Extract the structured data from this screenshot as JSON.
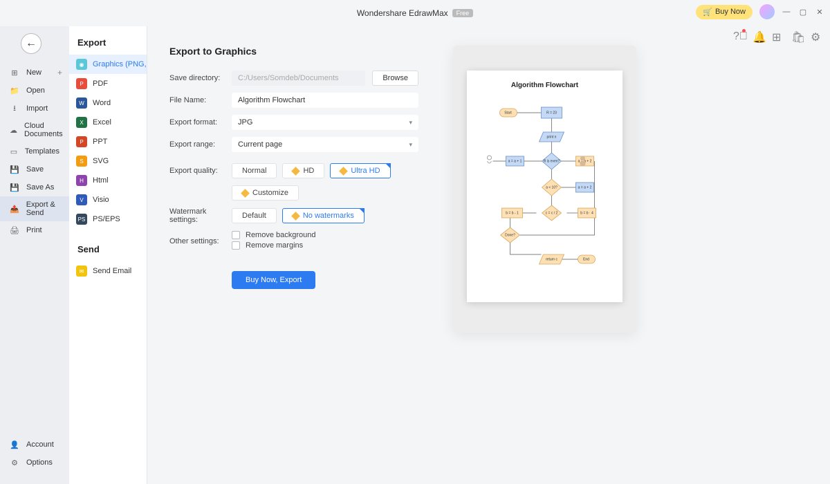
{
  "app": {
    "title": "Wondershare EdrawMax",
    "badge": "Free",
    "buy_now": "Buy Now"
  },
  "sidebar_a": {
    "items": [
      {
        "icon": "plus-box",
        "label": "New",
        "has_plus": true
      },
      {
        "icon": "folder",
        "label": "Open"
      },
      {
        "icon": "download",
        "label": "Import"
      },
      {
        "icon": "cloud",
        "label": "Cloud Documents"
      },
      {
        "icon": "template",
        "label": "Templates"
      },
      {
        "icon": "save",
        "label": "Save"
      },
      {
        "icon": "saveas",
        "label": "Save As"
      },
      {
        "icon": "export",
        "label": "Export & Send",
        "active": true
      },
      {
        "icon": "print",
        "label": "Print"
      }
    ],
    "bottom": [
      {
        "icon": "account",
        "label": "Account"
      },
      {
        "icon": "gear",
        "label": "Options"
      }
    ]
  },
  "sidebar_b": {
    "heading_export": "Export",
    "heading_send": "Send",
    "export_items": [
      {
        "cls": "fi-img",
        "label": "Graphics (PNG, JPG e...",
        "active": true
      },
      {
        "cls": "fi-pdf",
        "label": "PDF"
      },
      {
        "cls": "fi-word",
        "label": "Word"
      },
      {
        "cls": "fi-xls",
        "label": "Excel"
      },
      {
        "cls": "fi-ppt",
        "label": "PPT"
      },
      {
        "cls": "fi-svg",
        "label": "SVG"
      },
      {
        "cls": "fi-html",
        "label": "Html"
      },
      {
        "cls": "fi-visio",
        "label": "Visio"
      },
      {
        "cls": "fi-ps",
        "label": "PS/EPS"
      }
    ],
    "send_items": [
      {
        "cls": "fi-mail",
        "label": "Send Email"
      }
    ]
  },
  "form": {
    "heading": "Export to Graphics",
    "labels": {
      "save_dir": "Save directory:",
      "file_name": "File Name:",
      "export_format": "Export format:",
      "export_range": "Export range:",
      "export_quality": "Export quality:",
      "watermark": "Watermark settings:",
      "other": "Other settings:"
    },
    "values": {
      "save_dir": "C:/Users/Somdeb/Documents",
      "file_name": "Algorithm Flowchart",
      "export_format": "JPG",
      "export_range": "Current page"
    },
    "browse": "Browse",
    "quality": {
      "normal": "Normal",
      "hd": "HD",
      "ultra": "Ultra HD",
      "customize": "Customize"
    },
    "watermark": {
      "default": "Default",
      "none": "No watermarks"
    },
    "other": {
      "remove_bg": "Remove background",
      "remove_margins": "Remove margins"
    },
    "submit": "Buy Now, Export"
  },
  "preview": {
    "title": "Algorithm Flowchart",
    "nodes": {
      "start": "Start",
      "n1": "R = 23",
      "n2": "print n",
      "n3": "a = a + 1",
      "d1": "R is even?",
      "n4": "b = b - 1",
      "d2": "a < 10?",
      "n5": "a = a + 2",
      "n6": "c = c / 2",
      "n7": "b = b · 4",
      "d3": "Done?",
      "n8": "return c",
      "end": "End"
    }
  }
}
